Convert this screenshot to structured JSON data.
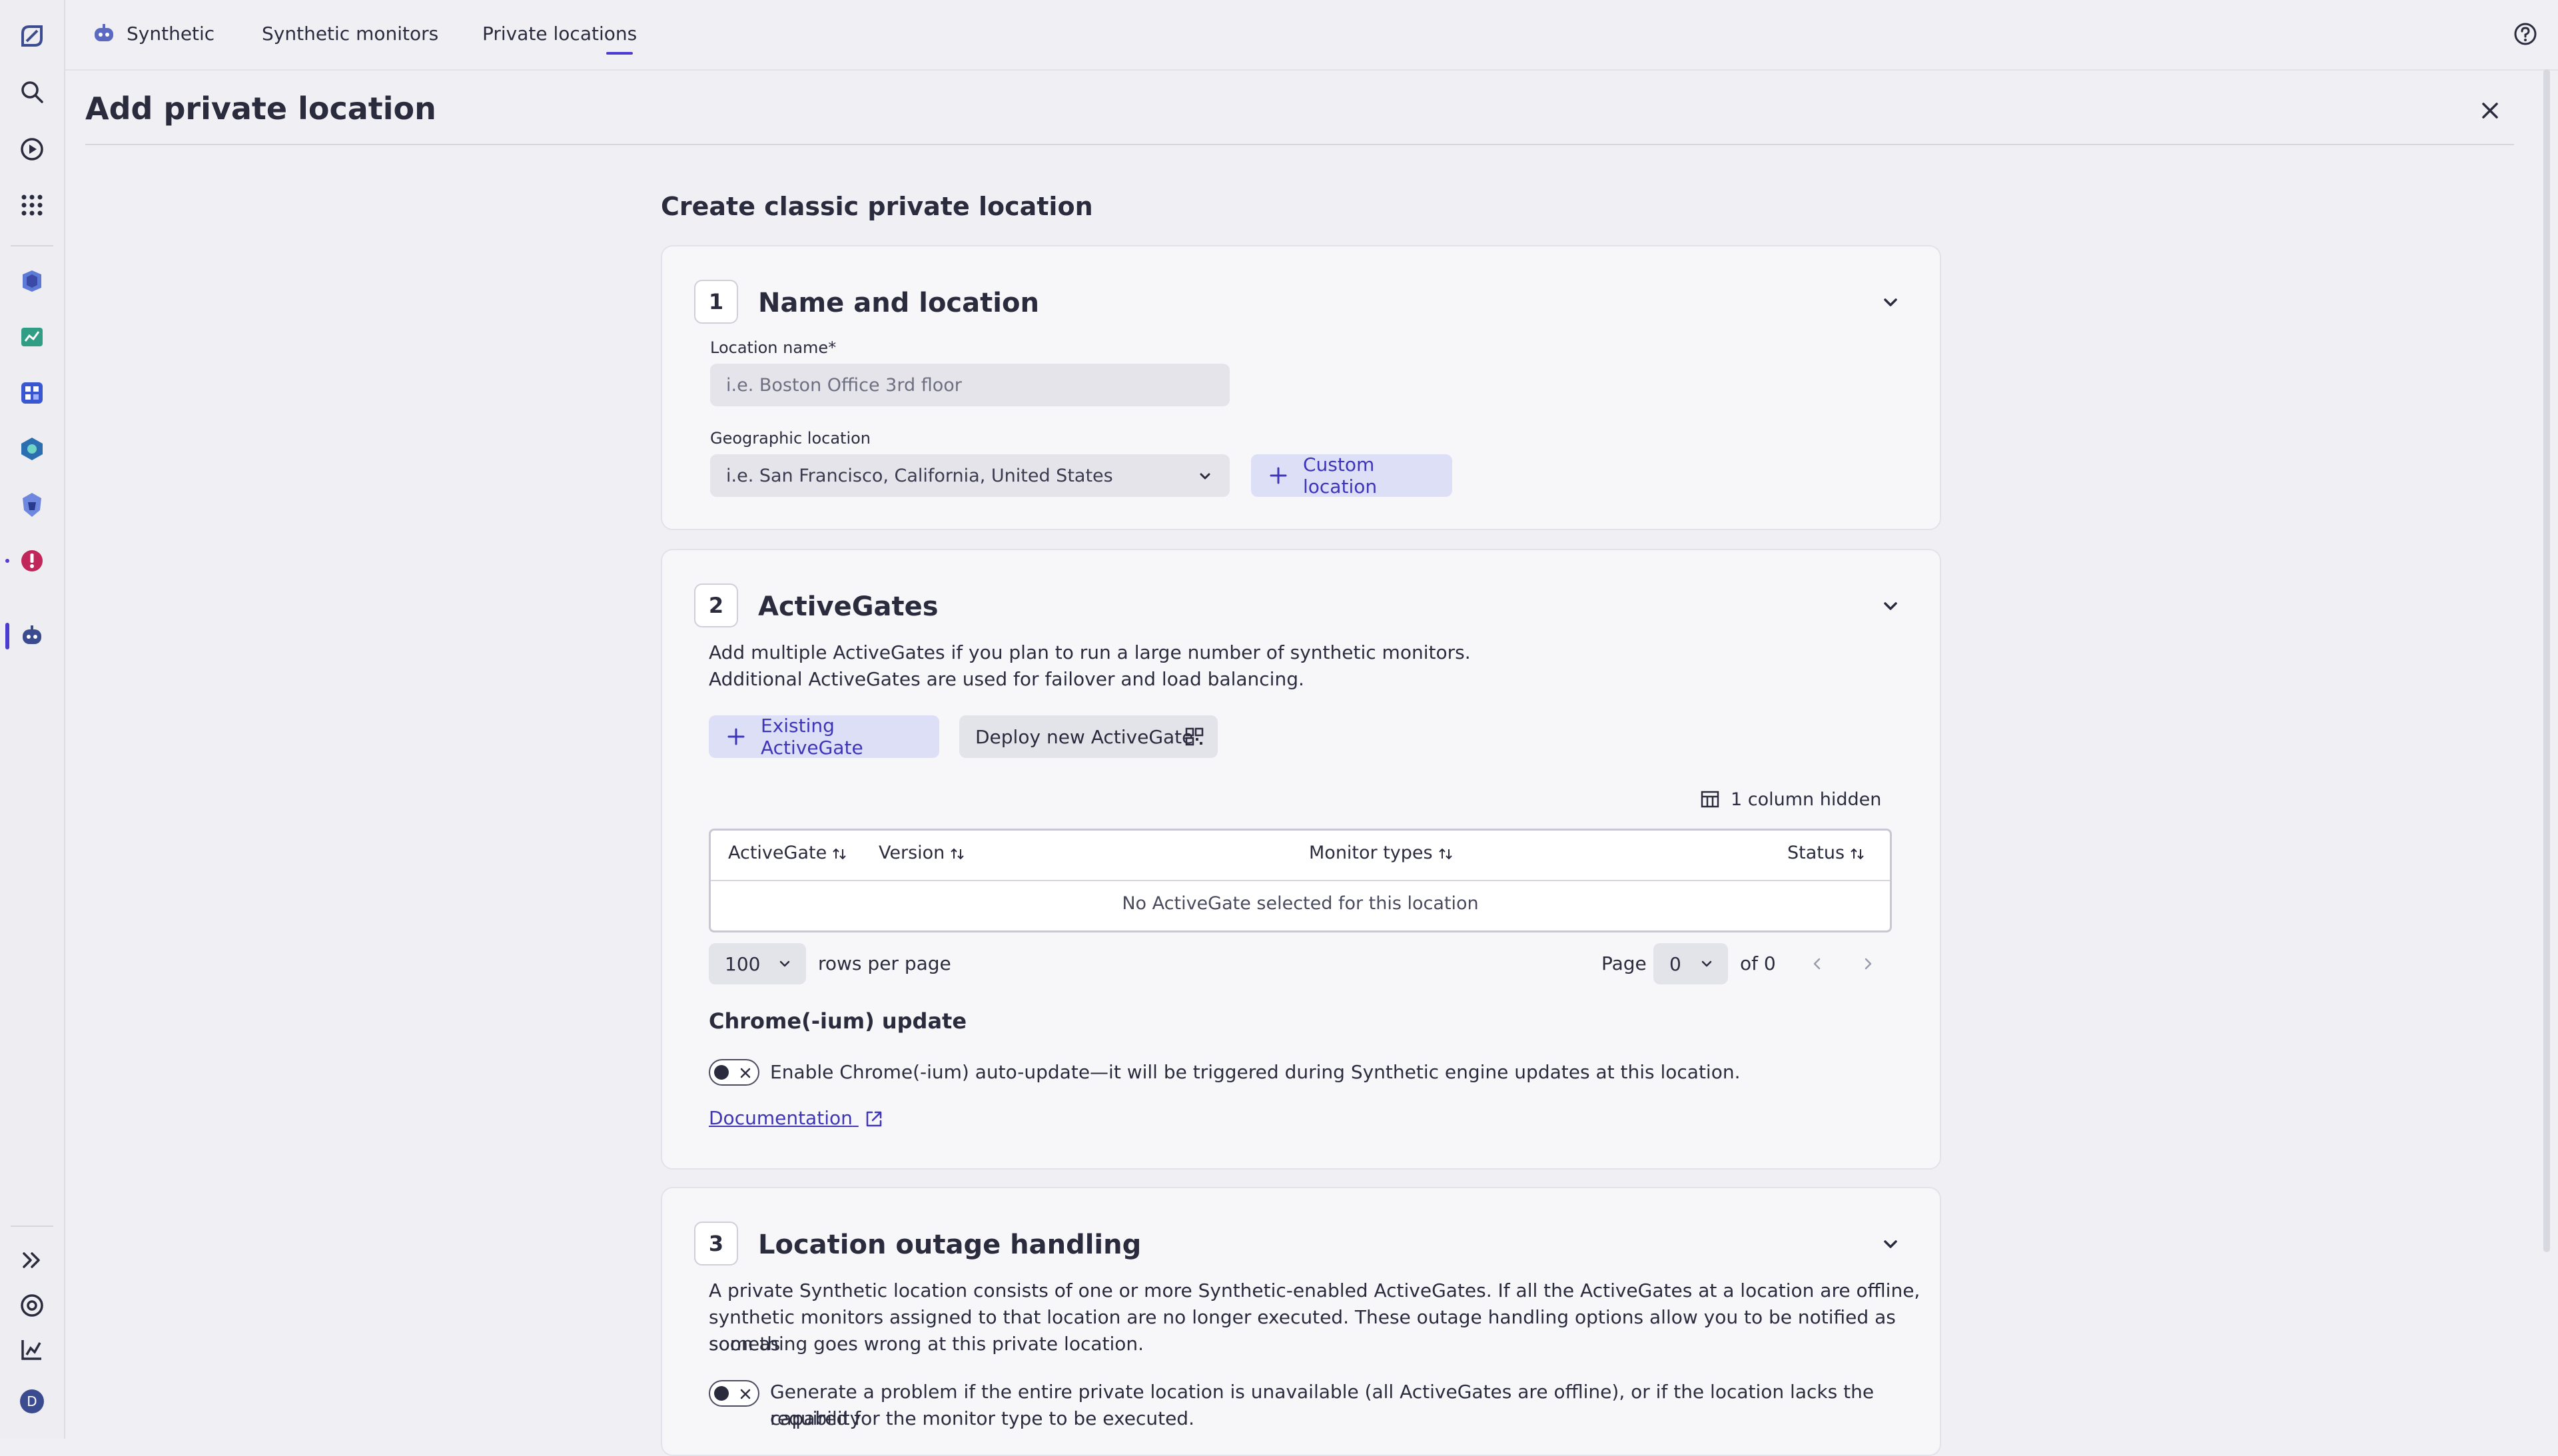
{
  "topbar": {
    "app_name": "Synthetic",
    "tabs": [
      "Synthetic monitors",
      "Private locations"
    ]
  },
  "page": {
    "title": "Add private location",
    "section_heading": "Create classic private location"
  },
  "step1": {
    "number": "1",
    "title": "Name and location",
    "location_name_label": "Location name*",
    "location_name_placeholder": "i.e. Boston Office 3rd floor",
    "geo_label": "Geographic location",
    "geo_placeholder": "i.e. San Francisco, California, United States",
    "custom_location_label": "Custom location"
  },
  "step2": {
    "number": "2",
    "title": "ActiveGates",
    "description_line1": "Add multiple ActiveGates if you plan to run a large number of synthetic monitors.",
    "description_line2": "Additional ActiveGates are used for failover and load balancing.",
    "existing_button": "Existing ActiveGate",
    "deploy_button": "Deploy new ActiveGate",
    "columns_hidden": "1 column hidden",
    "table": {
      "columns": [
        "ActiveGate",
        "Version",
        "Monitor types",
        "Status"
      ],
      "empty_message": "No ActiveGate selected for this location"
    },
    "pagination": {
      "rows_per_page_value": "100",
      "rows_per_page_label": "rows per page",
      "page_label": "Page",
      "page_value": "0",
      "of_label": "of 0"
    },
    "chrome_heading": "Chrome(-ium) update",
    "chrome_toggle_label": "Enable Chrome(-ium) auto-update—it will be triggered during Synthetic engine updates at this location.",
    "documentation_link": "Documentation"
  },
  "step3": {
    "number": "3",
    "title": "Location outage handling",
    "description_line1": "A private Synthetic location consists of one or more Synthetic-enabled ActiveGates. If all the ActiveGates at a location are offline,",
    "description_line2": "synthetic monitors assigned to that location are no longer executed. These outage handling options allow you to be notified as soon as",
    "description_line3": "something goes wrong at this private location.",
    "problem_toggle_line1": "Generate a problem if the entire private location is unavailable (all ActiveGates are offline), or if the location lacks the capability",
    "problem_toggle_line2": "required for the monitor type to be executed."
  },
  "rail": {
    "avatar_initial": "D"
  },
  "colors": {
    "accent": "#4b3bd3",
    "accent_bg": "#dddff7",
    "background": "#f0f0f4"
  }
}
